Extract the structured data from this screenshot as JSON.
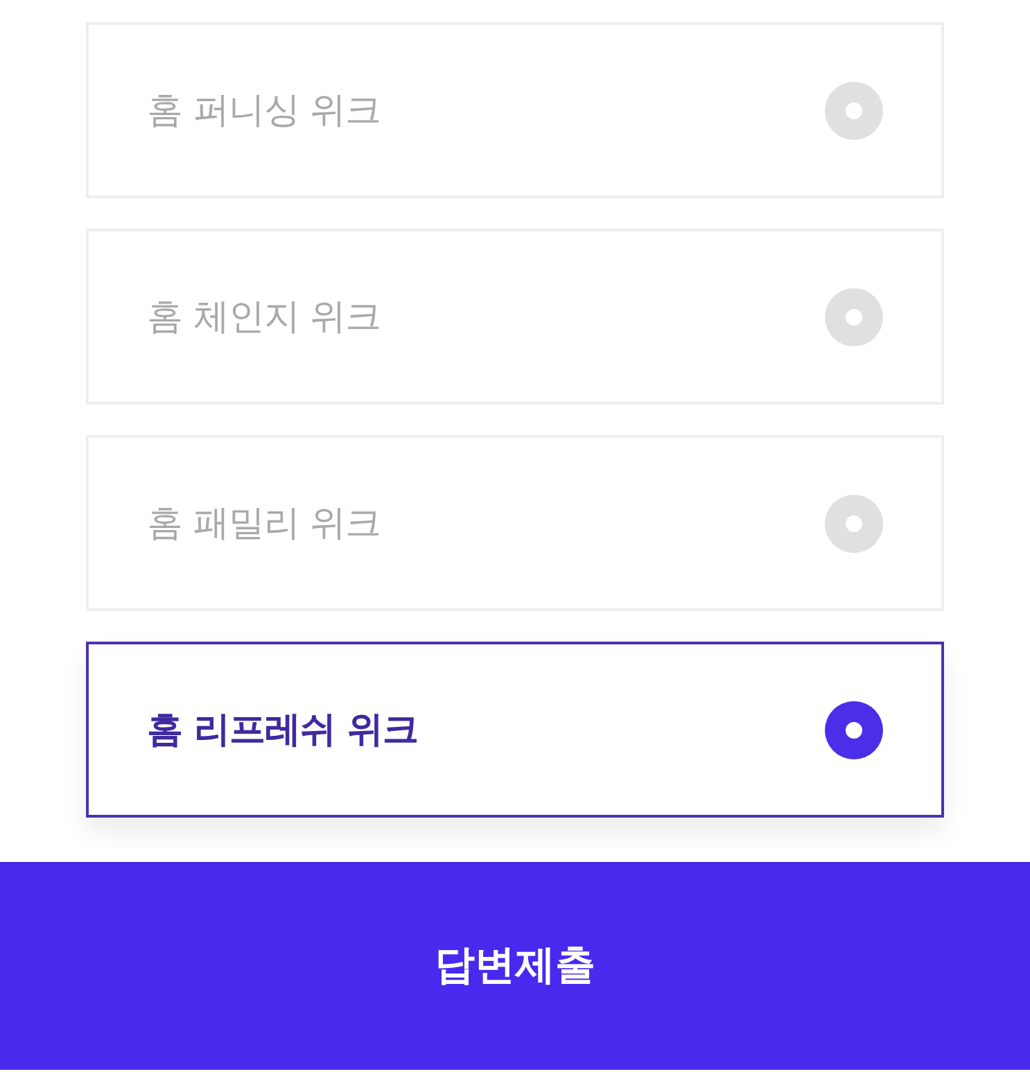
{
  "options": [
    {
      "label": "홈 퍼니싱 위크",
      "selected": false
    },
    {
      "label": "홈 체인지 위크",
      "selected": false
    },
    {
      "label": "홈 패밀리 위크",
      "selected": false
    },
    {
      "label": "홈 리프레쉬 위크",
      "selected": true
    }
  ],
  "submit_button": {
    "label": "답변제출"
  }
}
